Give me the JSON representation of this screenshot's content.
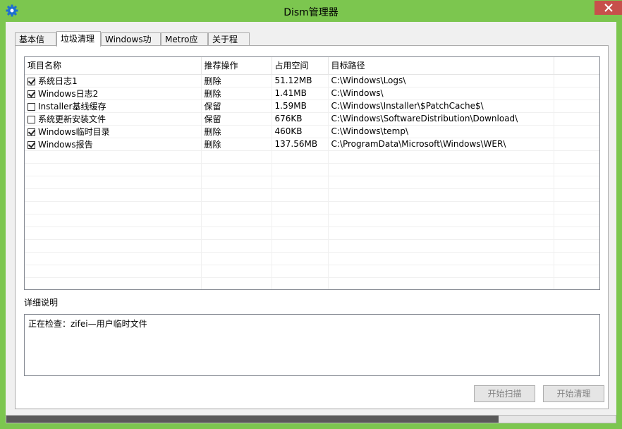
{
  "window": {
    "title": "Dism管理器"
  },
  "tabs": [
    {
      "label": "基本信息",
      "active": false
    },
    {
      "label": "垃圾清理",
      "active": true
    },
    {
      "label": "Windows功能",
      "active": false
    },
    {
      "label": "Metro应用",
      "active": false
    },
    {
      "label": "关于程序",
      "active": false
    }
  ],
  "table": {
    "headers": [
      "项目名称",
      "推荐操作",
      "占用空间",
      "目标路径"
    ],
    "rows": [
      {
        "checked": true,
        "name": "系统日志1",
        "action": "删除",
        "size": "51.12MB",
        "path": "C:\\Windows\\Logs\\"
      },
      {
        "checked": true,
        "name": "Windows日志2",
        "action": "删除",
        "size": "1.41MB",
        "path": "C:\\Windows\\"
      },
      {
        "checked": false,
        "name": "Installer基线缓存",
        "action": "保留",
        "size": "1.59MB",
        "path": "C:\\Windows\\Installer\\$PatchCache$\\"
      },
      {
        "checked": false,
        "name": "系统更新安装文件",
        "action": "保留",
        "size": "676KB",
        "path": "C:\\Windows\\SoftwareDistribution\\Download\\"
      },
      {
        "checked": true,
        "name": "Windows临时目录",
        "action": "删除",
        "size": "460KB",
        "path": "C:\\Windows\\temp\\"
      },
      {
        "checked": true,
        "name": "Windows报告",
        "action": "删除",
        "size": "137.56MB",
        "path": "C:\\ProgramData\\Microsoft\\Windows\\WER\\"
      }
    ]
  },
  "detail": {
    "label": "详细说明",
    "text": "正在检查：zifei—用户临时文件"
  },
  "buttons": {
    "scan": "开始扫描",
    "clean": "开始清理"
  },
  "progress": {
    "value": 0.808
  },
  "colors": {
    "frame": "#7cc64f",
    "close": "#c7504b",
    "icon": "#1e6fd0"
  }
}
